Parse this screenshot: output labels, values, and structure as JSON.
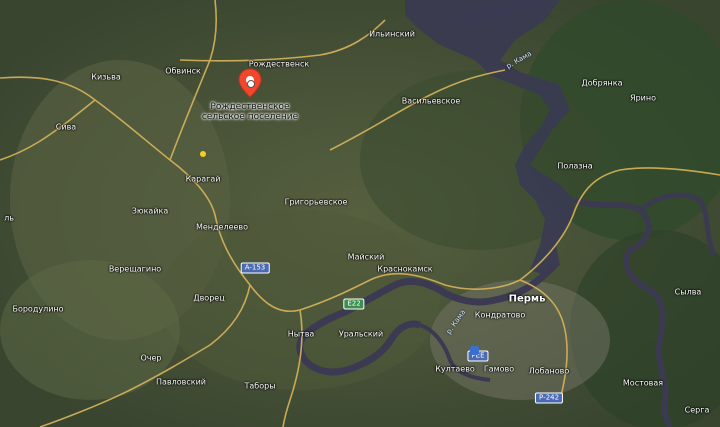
{
  "map": {
    "pin_label_line1": "Рождественское",
    "pin_label_line2": "сельское поселение",
    "places": {
      "obvinsk": "Обвинск",
      "rozhdestvensk": "Рождественск",
      "ilinsky": "Ильинский",
      "kizva": "Кизьва",
      "siva": "Сива",
      "karagay": "Карагай",
      "zyukayka": "Зюкайка",
      "menderevo": "Менделеево",
      "grigorievskoe": "Григорьевское",
      "vasilievskoe": "Васильевское",
      "dobryanka": "Добрянка",
      "yarino": "Ярино",
      "polazna": "Полазна",
      "maysky": "Майский",
      "krasnokamsk": "Краснокамск",
      "vereshchagino": "Верещагино",
      "dvorets": "Дворец",
      "nytva": "Нытва",
      "uralsky": "Уральский",
      "perm": "Пермь",
      "kondratovo": "Кондратово",
      "borodulino": "Бородулино",
      "ocher": "Очер",
      "kultaevo": "Култаево",
      "gamovo": "Гамово",
      "lobanovo": "Лобаново",
      "pavlovsky": "Павловский",
      "tabory": "Таборы",
      "mostovaya": "Мостовая",
      "sylva": "Сылва",
      "serga": "Серга",
      "partial_left": "ль"
    },
    "rivers": {
      "kama_north": "р. Кама",
      "kama_south": "р. Кама"
    },
    "roads": {
      "a153": "A-153",
      "e22": "E22",
      "r242": "Р-242",
      "pee": "PEE"
    }
  }
}
